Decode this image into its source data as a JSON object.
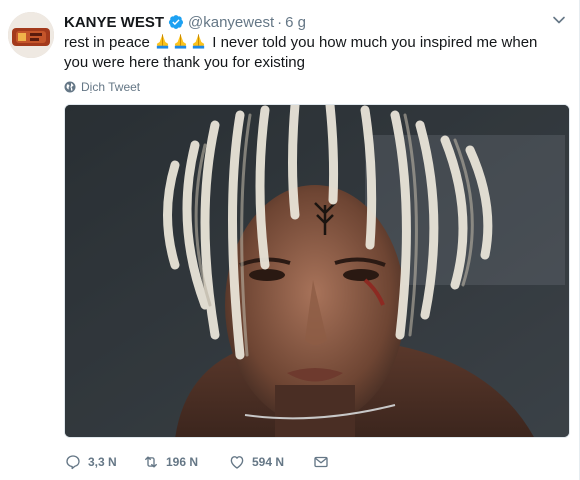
{
  "tweet": {
    "display_name": "KANYE WEST",
    "handle": "@kanyewest",
    "separator": "·",
    "time": "6 g",
    "text_part1": "rest in peace ",
    "text_part2": " I never told you how much you inspired me when you were here   thank you for existing",
    "translate_label": "Dịch Tweet",
    "emoji": "folded-hands-emoji",
    "verified_icon": "verified-badge-icon"
  },
  "actions": {
    "reply_count": "3,3 N",
    "retweet_count": "196 N",
    "like_count": "594 N"
  },
  "colors": {
    "verified": "#1da1f2",
    "secondary_text": "#657786",
    "primary_text": "#14171a"
  }
}
